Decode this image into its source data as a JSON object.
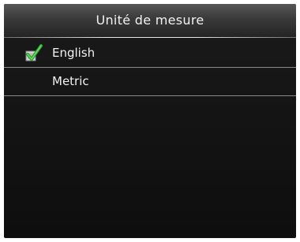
{
  "title": "Unité de mesure",
  "menu": {
    "items": [
      {
        "label": "English",
        "selected": true,
        "icon": "checkmark-icon"
      },
      {
        "label": "Metric",
        "selected": false
      }
    ]
  },
  "colors": {
    "background": "#111111",
    "title_bar": "#3a3a3a",
    "text": "#f2f2f2",
    "check": "#3fbf3f",
    "divider": "#8a8a8a"
  }
}
